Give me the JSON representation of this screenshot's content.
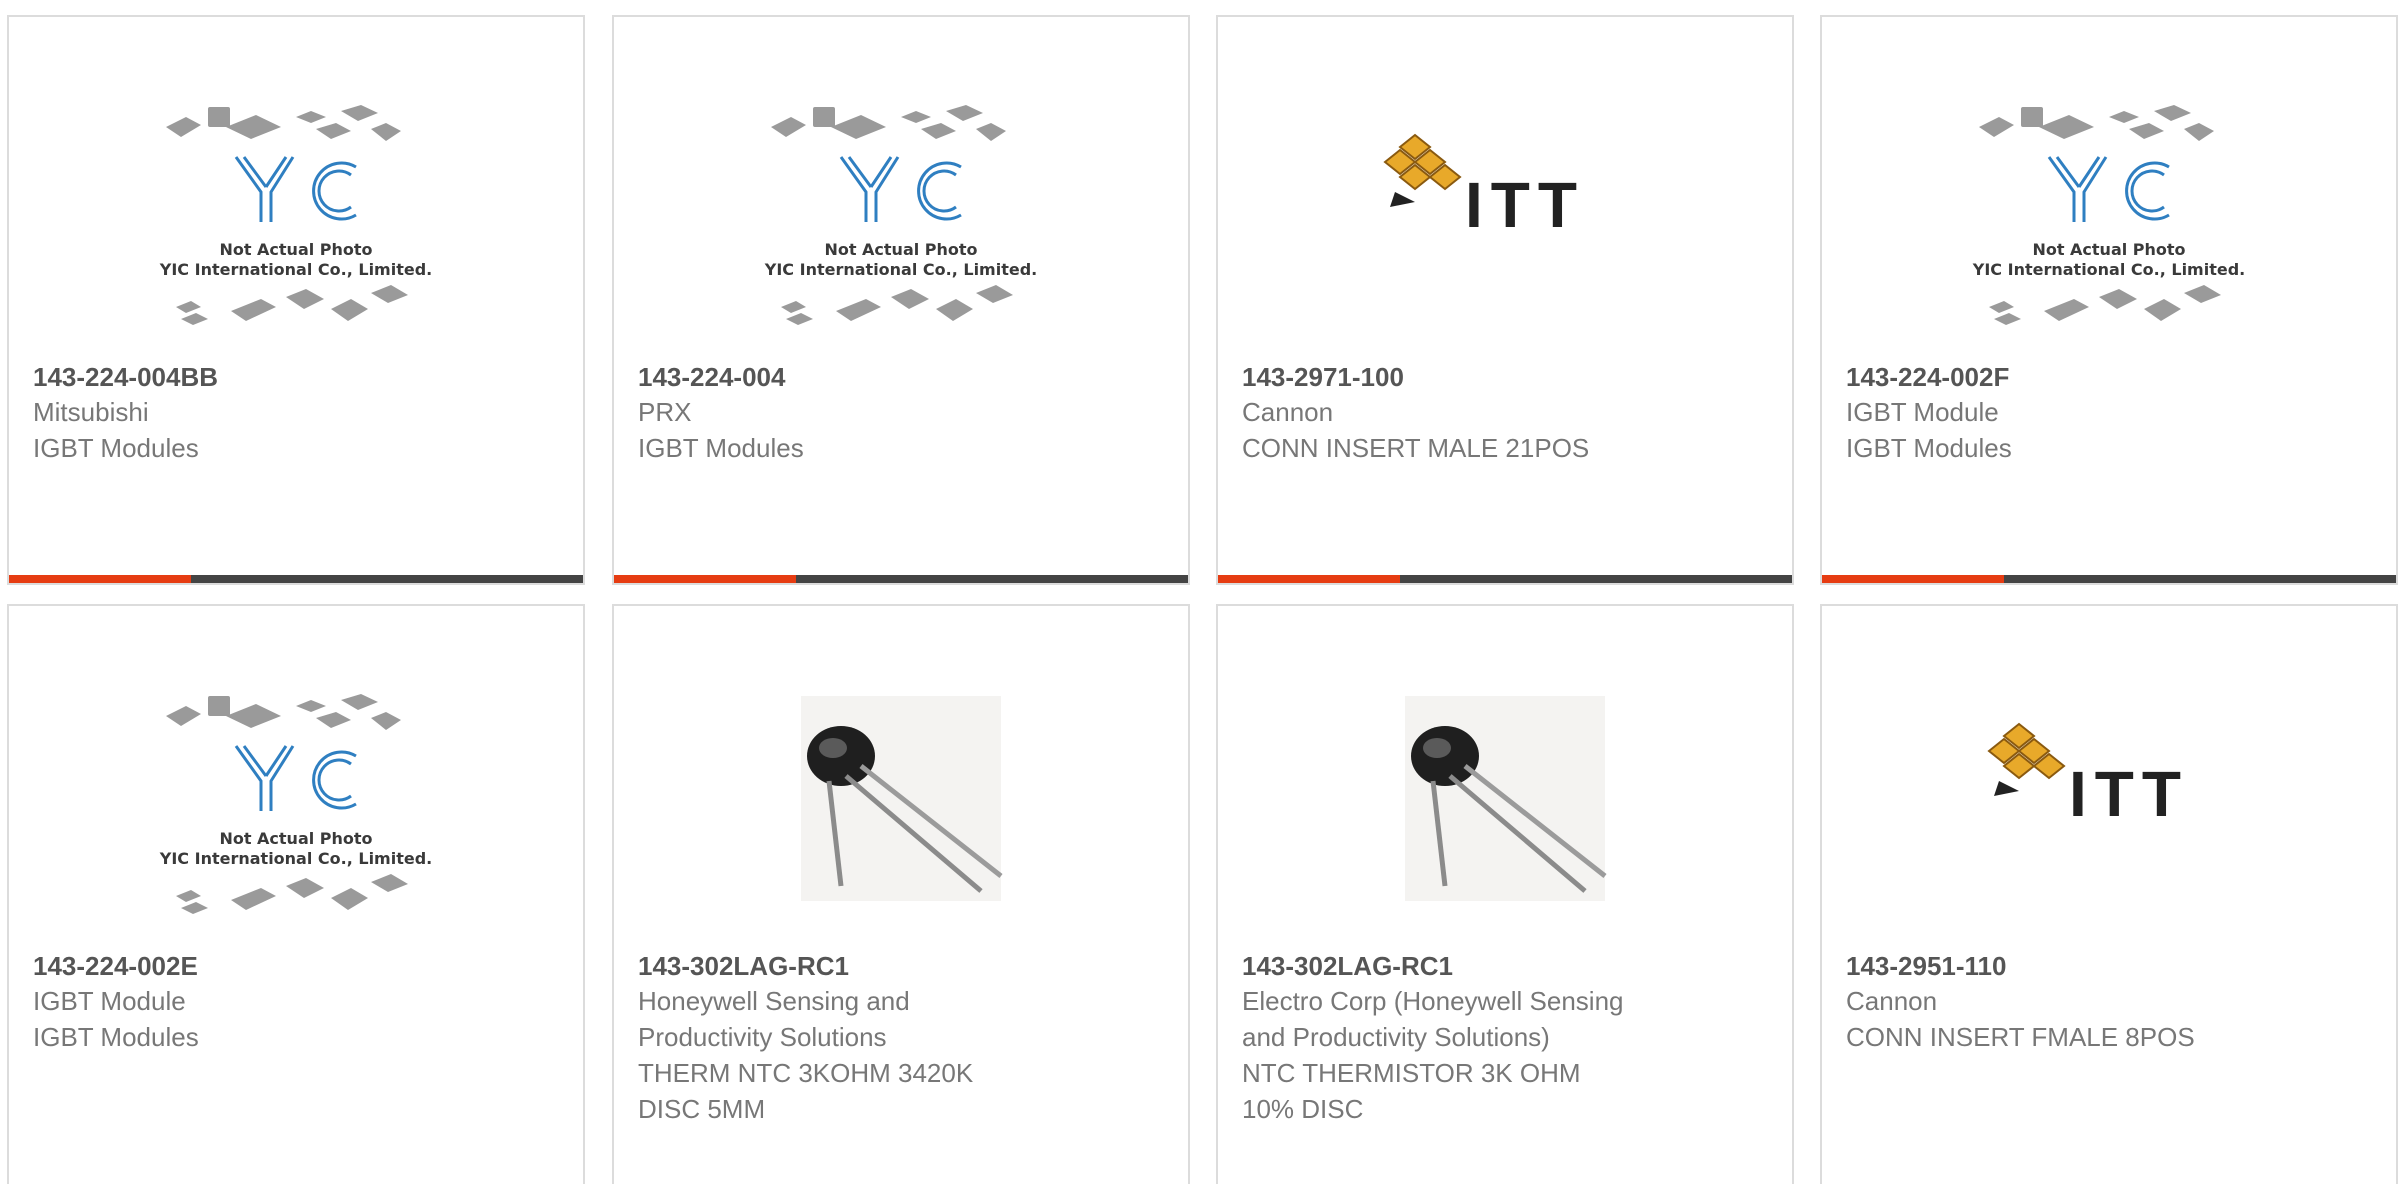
{
  "accent_color": "#e63c12",
  "cards": [
    {
      "image": "yic-placeholder",
      "part_number": "143-224-004BB",
      "lines": [
        "Mitsubishi",
        "IGBT Modules"
      ]
    },
    {
      "image": "yic-placeholder",
      "part_number": "143-224-004",
      "lines": [
        "PRX",
        "IGBT Modules"
      ]
    },
    {
      "image": "itt-logo",
      "part_number": "143-2971-100",
      "lines": [
        "Cannon",
        "CONN INSERT MALE 21POS"
      ]
    },
    {
      "image": "yic-placeholder",
      "part_number": "143-224-002F",
      "lines": [
        "IGBT Module",
        "IGBT Modules"
      ]
    },
    {
      "image": "yic-placeholder",
      "part_number": "143-224-002E",
      "lines": [
        "IGBT Module",
        "IGBT Modules"
      ]
    },
    {
      "image": "thermistor-photo",
      "part_number": "143-302LAG-RC1",
      "lines": [
        "Honeywell Sensing and",
        "Productivity Solutions",
        "THERM NTC 3KOHM 3420K",
        "DISC 5MM"
      ]
    },
    {
      "image": "thermistor-photo",
      "part_number": "143-302LAG-RC1",
      "lines": [
        "Electro Corp (Honeywell Sensing",
        "and Productivity Solutions)",
        "NTC THERMISTOR 3K OHM",
        "10% DISC"
      ]
    },
    {
      "image": "itt-logo",
      "part_number": "143-2951-110",
      "lines": [
        "Cannon",
        "CONN INSERT FMALE 8POS"
      ]
    }
  ],
  "yic_placeholder": {
    "line1": "Not Actual Photo",
    "line2": "YIC International Co., Limited."
  },
  "itt_logo_text": "ITT"
}
